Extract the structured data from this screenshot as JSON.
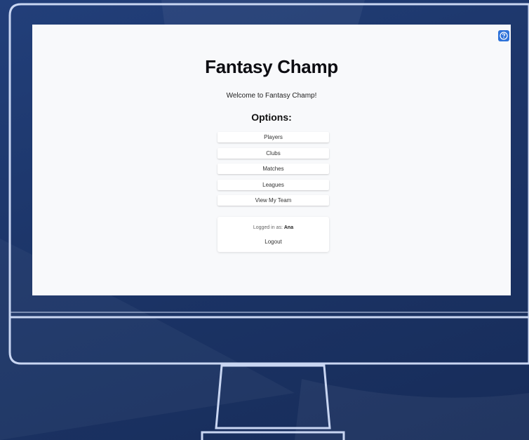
{
  "app": {
    "title": "Fantasy Champ",
    "welcome": "Welcome to Fantasy Champ!",
    "options_heading": "Options:"
  },
  "menu": {
    "items": [
      {
        "label": "Players"
      },
      {
        "label": "Clubs"
      },
      {
        "label": "Matches"
      },
      {
        "label": "Leagues"
      },
      {
        "label": "View My Team"
      }
    ]
  },
  "session": {
    "logged_in_prefix": "Logged in as:",
    "username": "Ana",
    "logout_label": "Logout"
  },
  "help": {
    "icon": "help-icon"
  },
  "colors": {
    "background": "#1c3568",
    "screen": "#f8f9fb",
    "monitor_outline": "#c9d6f2",
    "help_button": "#2f73d9"
  }
}
